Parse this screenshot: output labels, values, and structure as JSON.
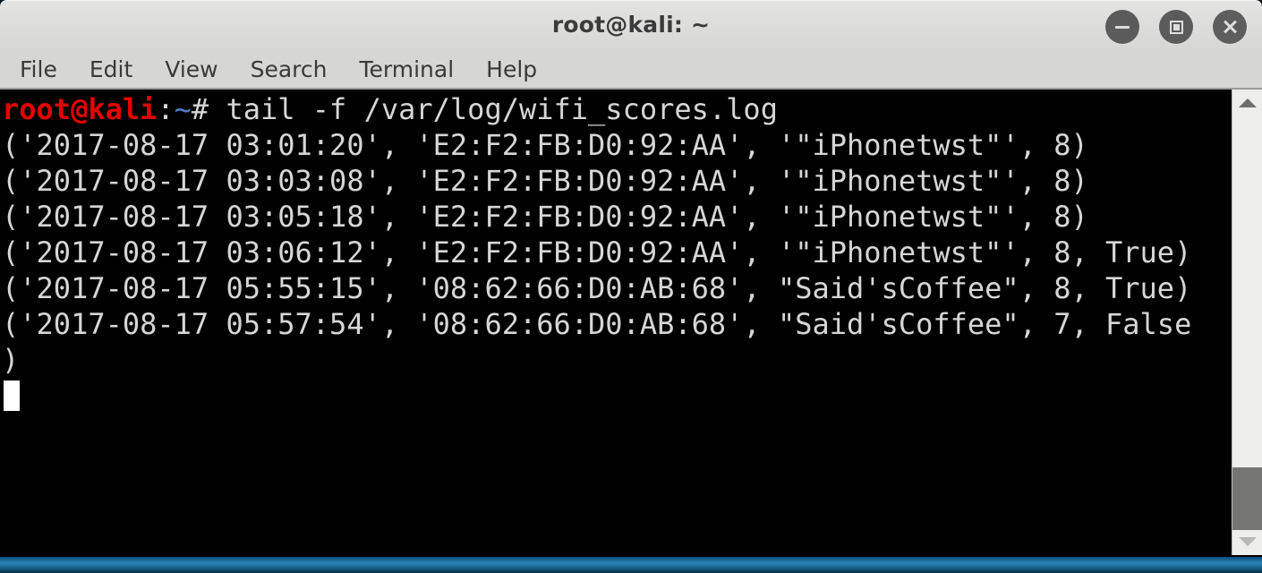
{
  "window": {
    "title": "root@kali: ~",
    "controls": [
      {
        "name": "minimize",
        "label": "Minimize"
      },
      {
        "name": "maximize",
        "label": "Maximize"
      },
      {
        "name": "close",
        "label": "Close"
      }
    ]
  },
  "menubar": {
    "items": [
      {
        "label": "File"
      },
      {
        "label": "Edit"
      },
      {
        "label": "View"
      },
      {
        "label": "Search"
      },
      {
        "label": "Terminal"
      },
      {
        "label": "Help"
      }
    ]
  },
  "terminal": {
    "prompt": {
      "user_host": "root@kali",
      "colon": ":",
      "path": "~",
      "sigil": "# ",
      "command": "tail -f /var/log/wifi_scores.log"
    },
    "output_lines": [
      "('2017-08-17 03:01:20', 'E2:F2:FB:D0:92:AA', '\"iPhonetwst\"', 8)",
      "('2017-08-17 03:03:08', 'E2:F2:FB:D0:92:AA', '\"iPhonetwst\"', 8)",
      "('2017-08-17 03:05:18', 'E2:F2:FB:D0:92:AA', '\"iPhonetwst\"', 8)",
      "('2017-08-17 03:06:12', 'E2:F2:FB:D0:92:AA', '\"iPhonetwst\"', 8, True)",
      "('2017-08-17 05:55:15', '08:62:66:D0:AB:68', \"Said'sCoffee\", 8, True)",
      "('2017-08-17 05:57:54', '08:62:66:D0:AB:68', \"Said'sCoffee\", 7, False",
      ")"
    ],
    "colors": {
      "background": "#000000",
      "foreground": "#d6d6d6",
      "prompt_user": "#e60000",
      "prompt_path": "#4a7fc1",
      "cursor": "#ffffff"
    }
  },
  "scrollbar": {
    "up_arrow": "scroll-up",
    "down_arrow": "scroll-down",
    "thumb": "scroll-thumb"
  }
}
